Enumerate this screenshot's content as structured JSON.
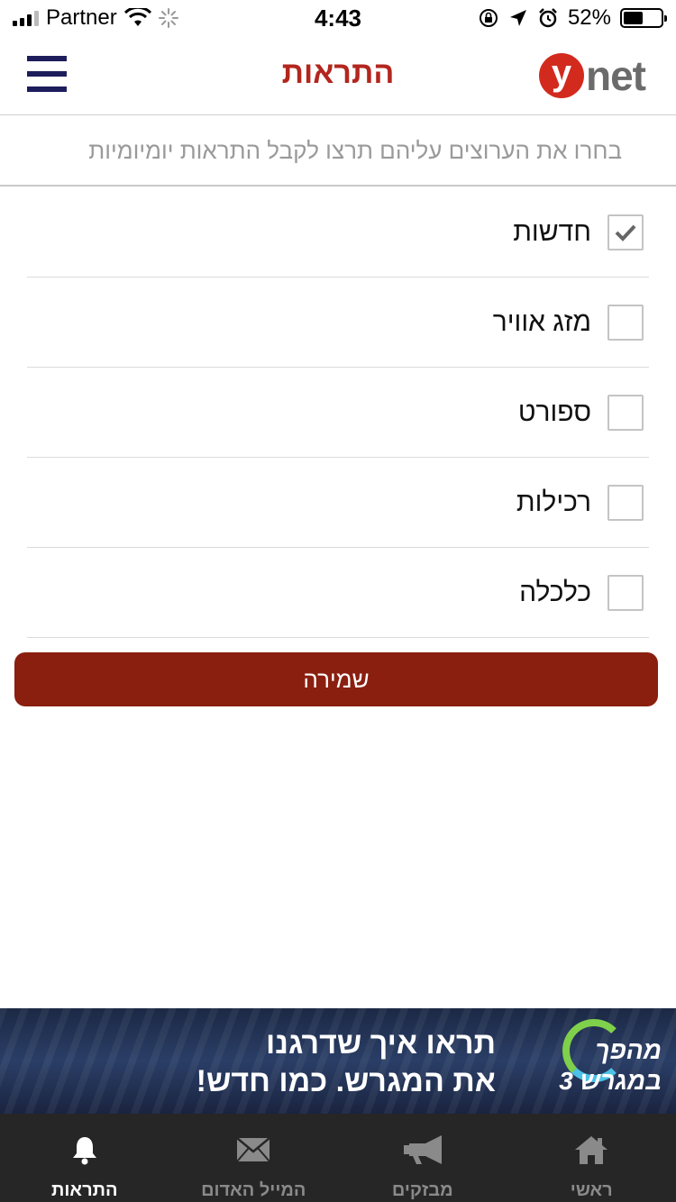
{
  "status_bar": {
    "carrier": "Partner",
    "time": "4:43",
    "battery_percent": "52%",
    "battery_level": 0.52
  },
  "header": {
    "logo_letter": "y",
    "logo_rest": "net",
    "title": "התראות"
  },
  "instruction": "בחרו את הערוצים עליהם תרצו לקבל התראות יומיומיות",
  "channels": [
    {
      "label": "חדשות",
      "checked": true
    },
    {
      "label": "מזג אוויר",
      "checked": false
    },
    {
      "label": "ספורט",
      "checked": false
    },
    {
      "label": "רכילות",
      "checked": false
    },
    {
      "label": "כלכלה",
      "checked": false
    }
  ],
  "save_label": "שמירה",
  "banner": {
    "line1": "תראו איך שדרגנו",
    "line2": "את המגרש. כמו חדש!",
    "logo_line1": "מהפך",
    "logo_line2": "במגרש 3"
  },
  "tabs": [
    {
      "label": "התראות",
      "icon": "bell-icon",
      "active": true
    },
    {
      "label": "המייל האדום",
      "icon": "mail-icon",
      "active": false
    },
    {
      "label": "מבזקים",
      "icon": "megaphone-icon",
      "active": false
    },
    {
      "label": "ראשי",
      "icon": "home-icon",
      "active": false
    }
  ],
  "colors": {
    "brand_red": "#b3261e",
    "save_button": "#8a1f10",
    "menu_icon": "#1e1d5c",
    "tabbar_bg": "#262626"
  }
}
